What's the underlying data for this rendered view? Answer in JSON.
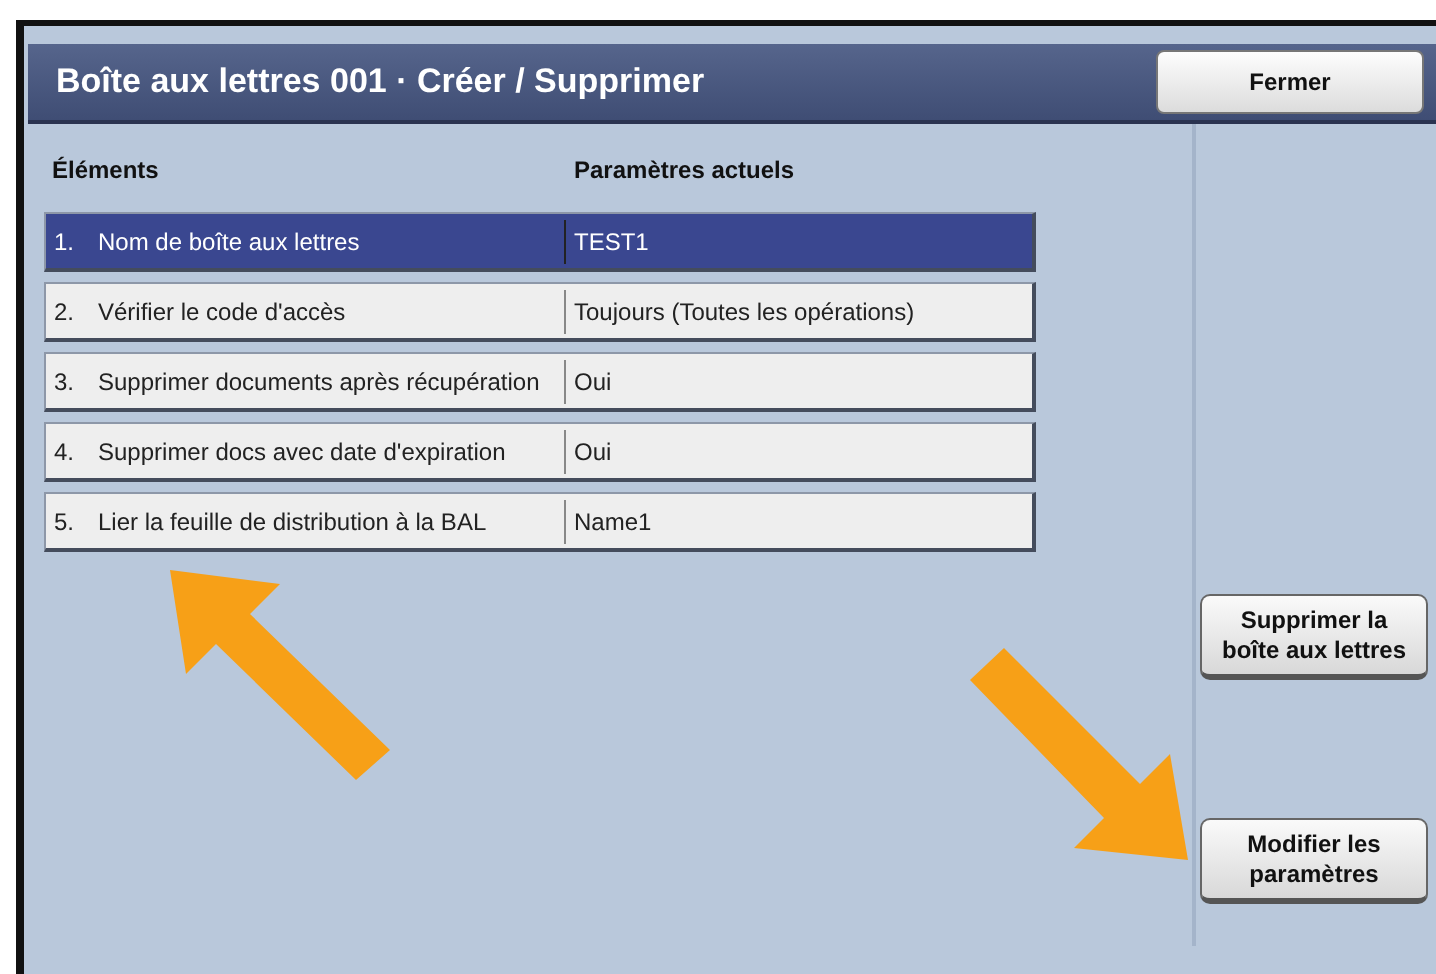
{
  "window": {
    "title": "Boîte aux lettres 001 · Créer / Supprimer",
    "close_button": "Fermer"
  },
  "table": {
    "columns": [
      "Éléments",
      "Paramètres actuels"
    ],
    "rows": [
      {
        "number": "1.",
        "item": "Nom de boîte aux lettres",
        "value": "TEST1",
        "selected": true
      },
      {
        "number": "2.",
        "item": "Vérifier le code d'accès",
        "value": "Toujours (Toutes les opérations)",
        "selected": false
      },
      {
        "number": "3.",
        "item": "Supprimer documents après récupération",
        "value": "Oui",
        "selected": false
      },
      {
        "number": "4.",
        "item": "Supprimer docs avec date d'expiration",
        "value": "Oui",
        "selected": false
      },
      {
        "number": "5.",
        "item": "Lier la feuille de distribution à la BAL",
        "value": "Name1",
        "selected": false
      }
    ]
  },
  "side_buttons": [
    "Supprimer la boîte aux lettres",
    "Modifier les paramètres"
  ],
  "callouts": [
    {
      "kind": "arrow-up-left"
    },
    {
      "kind": "arrow-down-right"
    }
  ]
}
